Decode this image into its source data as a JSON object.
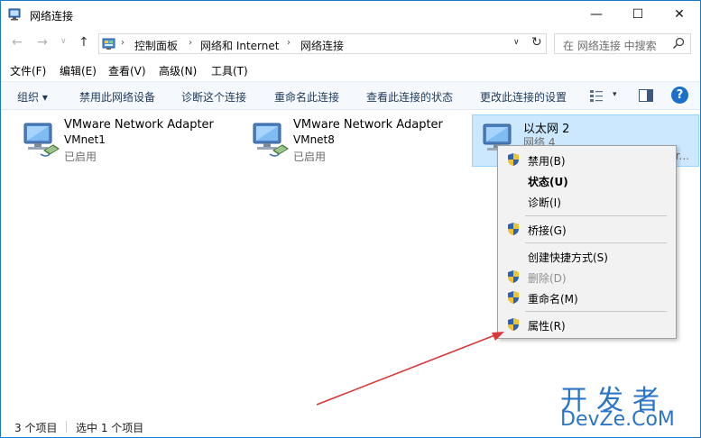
{
  "window": {
    "title": "网络连接",
    "minimize": "—",
    "maximize": "☐",
    "close": "✕"
  },
  "nav": {
    "back": "←",
    "forward": "→",
    "recent": "∨",
    "up": "↑",
    "breadcrumbs": [
      "控制面板",
      "网络和 Internet",
      "网络连接"
    ],
    "separator": "›",
    "dropdown": "∨",
    "refresh": "↻",
    "search_placeholder": "在 网络连接 中搜索"
  },
  "menu": [
    "文件(F)",
    "编辑(E)",
    "查看(V)",
    "高级(N)",
    "工具(T)"
  ],
  "toolbar": {
    "organize": "组织 ▾",
    "commands": [
      "禁用此网络设备",
      "诊断这个连接",
      "重命名此连接",
      "查看此连接的状态",
      "更改此连接的设置"
    ],
    "view_dropdown": "▾",
    "help": "?"
  },
  "adapters": [
    {
      "name": "VMware Network Adapter",
      "line2": "VMnet1",
      "status": "已启用",
      "selected": false
    },
    {
      "name": "VMware Network Adapter",
      "line2": "VMnet8",
      "status": "已启用",
      "selected": false
    },
    {
      "name": "以太网 2",
      "line2": "网络 4",
      "status": "tr...",
      "selected": true
    }
  ],
  "context_menu": [
    {
      "label": "禁用(B)",
      "shield": true,
      "bold": false,
      "disabled": false
    },
    {
      "label": "状态(U)",
      "shield": false,
      "bold": true,
      "disabled": false
    },
    {
      "label": "诊断(I)",
      "shield": false,
      "bold": false,
      "disabled": false
    },
    {
      "label": "桥接(G)",
      "shield": true,
      "bold": false,
      "disabled": false
    },
    {
      "label": "创建快捷方式(S)",
      "shield": false,
      "bold": false,
      "disabled": false
    },
    {
      "label": "删除(D)",
      "shield": true,
      "bold": false,
      "disabled": true
    },
    {
      "label": "重命名(M)",
      "shield": true,
      "bold": false,
      "disabled": false
    },
    {
      "label": "属性(R)",
      "shield": true,
      "bold": false,
      "disabled": false
    }
  ],
  "status": {
    "count": "3 个项目",
    "selected": "选中 1 个项目"
  },
  "watermark": {
    "top": "开发者",
    "bottom": "DevZe.CoM"
  },
  "colors": {
    "accent": "#1979ca",
    "selection": "#cce8ff",
    "arrow": "#d9383a",
    "watermark": "#2a75c6"
  }
}
